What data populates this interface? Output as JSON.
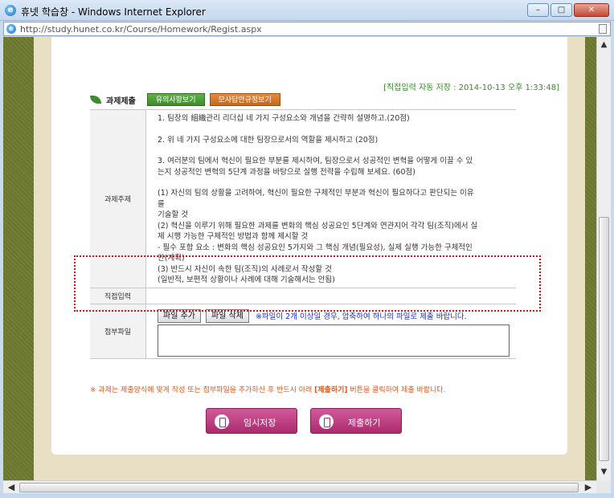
{
  "window": {
    "title": "휴넷 학습창 - Windows Internet Explorer",
    "buttons": {
      "minimize": "–",
      "maximize": "□",
      "close": "✕"
    }
  },
  "address": {
    "url": "http://study.hunet.co.kr/Course/Homework/Regist.aspx"
  },
  "autosave": "[직접입력 자동 저장 : 2014-10-13 오후 1:33:48]",
  "section": {
    "title": "과제제출",
    "btn_notice": "유의사항보기",
    "btn_sample": "모사답안규정보기"
  },
  "table": {
    "topic_label": "과제주제",
    "topic_lines": [
      "1. 팀장의 組織관리 리더십 네 가지 구성요소와 개념을 간략히 설명하고.(20점)",
      "2. 위 네 가지 구성요소에 대한 팀장으로서의 역할을 제시하고 (20점)",
      "3. 여러분의 팀에서 혁신이 필요한 부분를 제시하여, 팀장으로서 성공적인 변혁을 어떻게 이끌 수 있",
      "는지 성공적인 변혁의 5단계 과정을 바탕으로 실행 전략을 수립해 보세요. (60점)",
      "(1) 자신의 팀의 상황을 고려하여, 혁신이 필요한 구체적인 부분과 혁신이 필요하다고 판단되는 이유",
      "를",
      "기술할 것",
      "(2) 혁신을 이루기 위해 필요한 과제를 변화의 핵심 성공요인 5단계와 연관지어 각각 팀(조직)에서 실",
      "제 시행 가능한 구체적인 방법과 함께 제시할 것",
      "- 필수 포함 요소 : 변화의 핵심 성공요인 5가지와 그 핵심 개념(필요성), 실제 실행 가능한 구체적인",
      "안(계획)",
      "(3) 반드시 자신이 속한 팀(조직)의 사례로서 작성할 것",
      "(일반적, 보편적 상황이나 사례에 대해 기술해서는 안됨)"
    ],
    "direct_label": "직접입력",
    "file_label": "첨부파일",
    "btn_add_file": "파일 추가",
    "btn_delete_file": "파일 삭제",
    "file_note": "※파일이 2개 이상일 경우, 압축하여 하나의 파일로 제출 바랍니다."
  },
  "notice": {
    "before": "※ 과제는 제출양식에 맞게 작성 또는 첨부파일을 추가하신 후 반드시 아래 ",
    "strong": "[제출하기]",
    "after": " 버튼을 클릭하여 제출 바랍니다."
  },
  "actions": {
    "temp_save": "임시저장",
    "submit": "제출하기"
  },
  "colors": {
    "accent_green": "#3d8c2b",
    "accent_magenta": "#a92b6d",
    "highlight_red": "#e0101a",
    "notice_orange": "#e2561c",
    "note_blue": "#1a2fd0"
  }
}
